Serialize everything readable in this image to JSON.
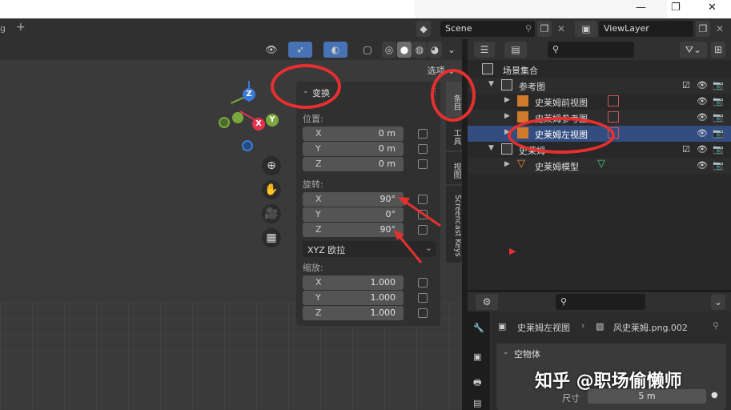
{
  "topbar": {
    "tab_fragment": "g",
    "add_tab": "+",
    "scene_name": "Scene",
    "view_layer": "ViewLayer",
    "window_controls": [
      "—",
      "❐",
      "✕"
    ]
  },
  "viewport": {
    "options_label": "选项",
    "gizmo": {
      "z": "Z",
      "y": "Y",
      "x": "X"
    },
    "nav_icons": [
      "zoom-icon",
      "hand-icon",
      "camera-icon",
      "grid-icon"
    ]
  },
  "npanel": {
    "title": "变换",
    "location_label": "位置:",
    "location": [
      {
        "axis": "X",
        "value": "0 m"
      },
      {
        "axis": "Y",
        "value": "0 m"
      },
      {
        "axis": "Z",
        "value": "0 m"
      }
    ],
    "rotation_label": "旋转:",
    "rotation": [
      {
        "axis": "X",
        "value": "90°"
      },
      {
        "axis": "Y",
        "value": "0°"
      },
      {
        "axis": "Z",
        "value": "90°"
      }
    ],
    "rotation_mode": "XYZ 欧拉",
    "scale_label": "缩放:",
    "scale": [
      {
        "axis": "X",
        "value": "1.000"
      },
      {
        "axis": "Y",
        "value": "1.000"
      },
      {
        "axis": "Z",
        "value": "1.000"
      }
    ]
  },
  "side_tabs": [
    "条目",
    "工具",
    "视图",
    "Screencast Keys"
  ],
  "outliner": {
    "root": "场景集合",
    "rows": [
      {
        "label": "参考图"
      },
      {
        "label": "史莱姆前视图"
      },
      {
        "label": "史莱姆参考图"
      },
      {
        "label": "史莱姆左视图"
      },
      {
        "label": "史莱姆"
      },
      {
        "label": "史莱姆模型"
      }
    ]
  },
  "properties": {
    "object_name": "史莱姆左视图",
    "image_name": "风史莱姆.png.002",
    "panel_title": "空物体",
    "size_label": "尺寸",
    "size_value": "5 m"
  },
  "watermark": "知乎 @职场偷懒师",
  "colors": {
    "accent_blue": "#4772b3",
    "selection": "#334d80",
    "annotation_red": "#e63030",
    "gizmo_x": "#e5334d",
    "gizmo_y": "#7aa83c",
    "gizmo_z": "#3b7bd6"
  }
}
